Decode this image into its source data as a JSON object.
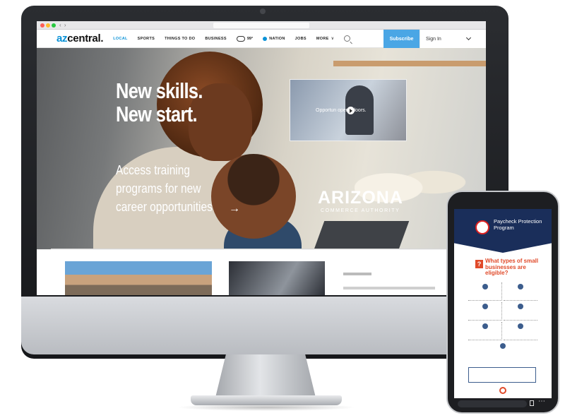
{
  "site": {
    "logo_prefix": "az",
    "logo_rest": "central.",
    "nav": [
      "LOCAL",
      "SPORTS",
      "THINGS TO DO",
      "BUSINESS"
    ],
    "weather_temp": "99°",
    "nation": "NATION",
    "jobs": "JOBS",
    "more": "MORE",
    "subscribe": "Subscribe",
    "signin": "Sign In"
  },
  "hero": {
    "headline_line1": "New skills.",
    "headline_line2": "New start.",
    "sub_line1": "Access training",
    "sub_line2": "programs for new",
    "sub_line3": "career opportunities",
    "video_caption": "Opportun    opens doors.",
    "brand": "ARIZONA",
    "brand_sub": "COMMERCE AUTHORITY"
  },
  "phone": {
    "ppp_title": "Paycheck Protection Program",
    "question": "What types of small businesses are eligible?",
    "q_mark": "?"
  },
  "colors": {
    "accent": "#0a92d7",
    "subscribe_bg": "#4aa6e5",
    "ppp_navy": "#1a2e5a",
    "ppp_red": "#e04a2a"
  },
  "icons": [
    "weather-icon",
    "nation-dot-icon",
    "search-icon",
    "chevron-down-icon",
    "play-icon",
    "arrow-right-icon",
    "question-icon"
  ]
}
